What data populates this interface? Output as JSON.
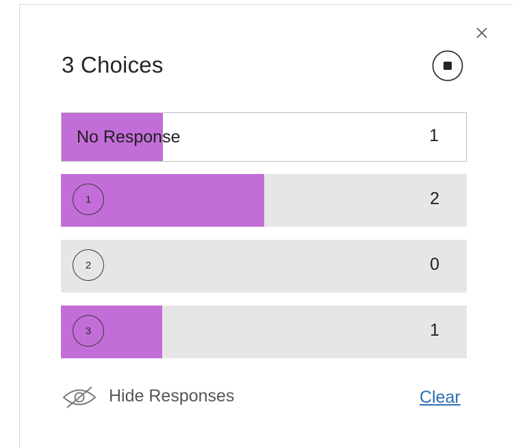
{
  "header": {
    "title": "3 Choices"
  },
  "icons": {
    "close": "close-icon",
    "stop": "stop-circle-icon",
    "hide": "eye-off-icon"
  },
  "colors": {
    "bar_fill": "#c36ed8",
    "row_bg": "#e6e6e6",
    "link": "#2b6fb6"
  },
  "rows": [
    {
      "label": "No Response",
      "count": "1",
      "fraction": 0.25
    },
    {
      "label": "1",
      "count": "2",
      "fraction": 0.5
    },
    {
      "label": "2",
      "count": "0",
      "fraction": 0
    },
    {
      "label": "3",
      "count": "1",
      "fraction": 0.25
    }
  ],
  "footer": {
    "hide_label": "Hide Responses",
    "clear_label": "Clear"
  }
}
